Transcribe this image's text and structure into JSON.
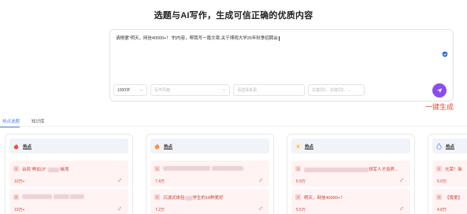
{
  "header": {
    "title": "选题与AI写作，生成可信正确的优质内容"
  },
  "editor": {
    "text": "请根据“明天，网信40000+！”的内容，帮我写一篇文章,关于博观大学25年秋季招聘会"
  },
  "controls": {
    "word_count": "1000字",
    "style_placeholder": "写作风格",
    "source_placeholder": "请选择来源",
    "keywords_placeholder": "关键词1、关键词2、..."
  },
  "send": {
    "tooltip": "一键生成"
  },
  "tabs": [
    {
      "label": "热点选题",
      "active": true
    },
    {
      "label": "知识库",
      "active": false
    }
  ],
  "cards": [
    {
      "label": "热点",
      "icon": "fire-icon",
      "items": [
        {
          "rank": "1",
          "text_prefix": "台风“桦加沙”",
          "text_suffix": "峡湾",
          "count": "10万+"
        },
        {
          "rank": "2",
          "text_prefix": "",
          "text_suffix": "",
          "count": "10万+"
        }
      ]
    },
    {
      "label": "热点",
      "icon": "flame-icon",
      "items": [
        {
          "rank": "1",
          "text_prefix": "",
          "text_suffix": "",
          "count": "7.4万"
        },
        {
          "rank": "2",
          "text_prefix": "沉浸式体验",
          "text_suffix": "学生的18种爱好",
          "count": "7.2万"
        }
      ]
    },
    {
      "label": "热点",
      "icon": "sun-icon",
      "items": [
        {
          "rank": "1",
          "text_prefix": "",
          "text_suffix": "领军人才培养…",
          "count": "5.9万"
        },
        {
          "rank": "2",
          "text_prefix": "明天，网信40000+！",
          "text_suffix": "",
          "count": "5.5万"
        }
      ]
    },
    {
      "label": "热点",
      "icon": "drop-icon",
      "items": [
        {
          "rank": "1",
          "text_prefix": "光荣！新",
          "text_suffix": "",
          "count": "5.0万"
        },
        {
          "rank": "2",
          "text_prefix": "【我爱】",
          "text_suffix": "",
          "count": "4.8万"
        }
      ]
    }
  ],
  "colors": {
    "accent": "#8b4cf0",
    "hot_text": "#c03e36",
    "hot_bg": "#fff4f3",
    "tab_active": "#4a7cf2",
    "tooltip": "#e14a3a"
  }
}
